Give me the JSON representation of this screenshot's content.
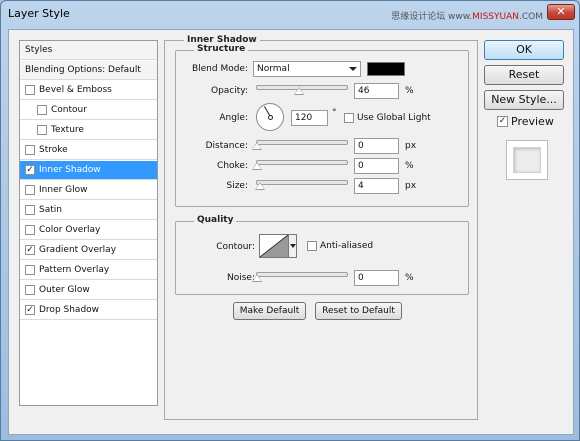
{
  "window": {
    "title": "Layer Style",
    "watermark_a": "思缘设计论坛 www.",
    "watermark_b": "MISSYUAN",
    "watermark_c": ".COM",
    "close_glyph": "✕"
  },
  "styles_list": {
    "header": "Styles",
    "blending": "Blending Options: Default",
    "items": [
      {
        "label": "Bevel & Emboss",
        "checked": false,
        "indent": false
      },
      {
        "label": "Contour",
        "checked": false,
        "indent": true
      },
      {
        "label": "Texture",
        "checked": false,
        "indent": true
      },
      {
        "label": "Stroke",
        "checked": false,
        "indent": false
      },
      {
        "label": "Inner Shadow",
        "checked": true,
        "indent": false,
        "selected": true
      },
      {
        "label": "Inner Glow",
        "checked": false,
        "indent": false
      },
      {
        "label": "Satin",
        "checked": false,
        "indent": false
      },
      {
        "label": "Color Overlay",
        "checked": false,
        "indent": false
      },
      {
        "label": "Gradient Overlay",
        "checked": true,
        "indent": false
      },
      {
        "label": "Pattern Overlay",
        "checked": false,
        "indent": false
      },
      {
        "label": "Outer Glow",
        "checked": false,
        "indent": false
      },
      {
        "label": "Drop Shadow",
        "checked": true,
        "indent": false
      }
    ]
  },
  "panel": {
    "title": "Inner Shadow",
    "structure": {
      "title": "Structure",
      "blend_mode_label": "Blend Mode:",
      "blend_mode_value": "Normal",
      "swatch_color": "#000000",
      "opacity_label": "Opacity:",
      "opacity_value": "46",
      "opacity_unit": "%",
      "opacity_fraction": 0.46,
      "angle_label": "Angle:",
      "angle_value": "120",
      "angle_unit": "°",
      "global_light_label": "Use Global Light",
      "global_light_checked": false,
      "distance_label": "Distance:",
      "distance_value": "0",
      "distance_unit": "px",
      "choke_label": "Choke:",
      "choke_value": "0",
      "choke_unit": "%",
      "size_label": "Size:",
      "size_value": "4",
      "size_unit": "px"
    },
    "quality": {
      "title": "Quality",
      "contour_label": "Contour:",
      "antialiased_label": "Anti-aliased",
      "antialiased_checked": false,
      "noise_label": "Noise:",
      "noise_value": "0",
      "noise_unit": "%"
    },
    "make_default": "Make Default",
    "reset_default": "Reset to Default"
  },
  "right": {
    "ok": "OK",
    "reset": "Reset",
    "new_style": "New Style...",
    "preview_label": "Preview",
    "preview_checked": true
  }
}
